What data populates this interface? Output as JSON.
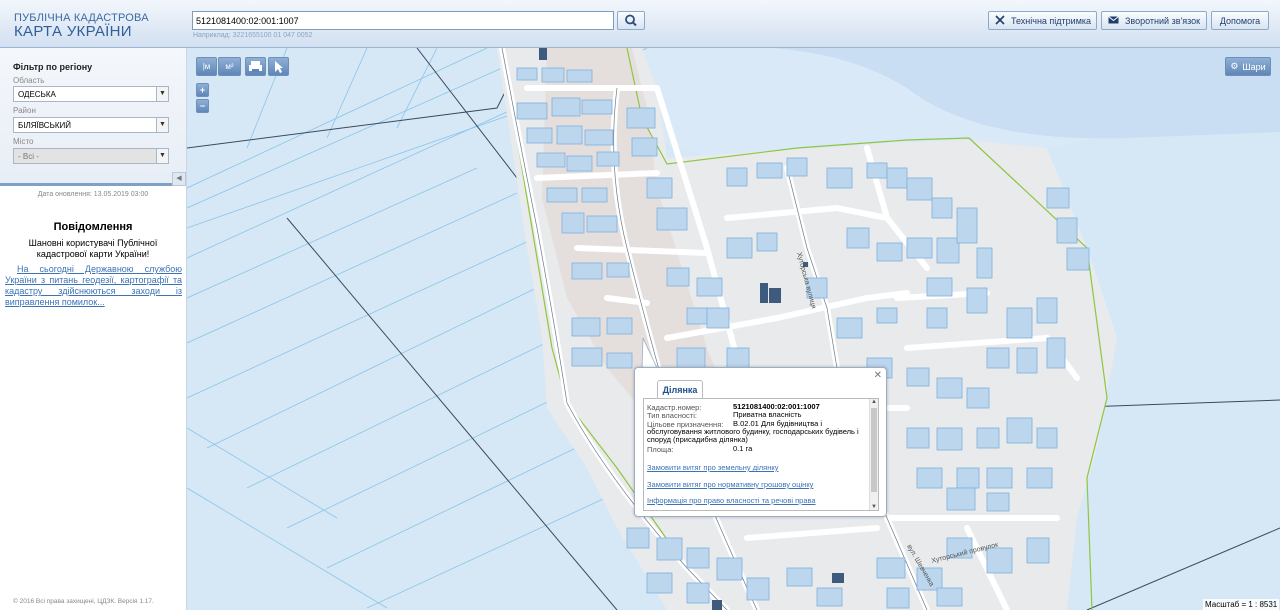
{
  "header": {
    "logo_line1": "ПУБЛІЧНА КАДАСТРОВА",
    "logo_line2": "КАРТА УКРАЇНИ",
    "search_value": "5121081400:02:001:1007",
    "search_example": "Наприклад: 3221655100 01 047 0052",
    "buttons": {
      "support": "Технічна підтримка",
      "feedback": "Зворотний зв'язок",
      "help": "Допомога"
    }
  },
  "sidebar": {
    "filter_title": "Фільтр по регіону",
    "region_label": "Область",
    "region_value": "ОДЕСЬКА",
    "district_label": "Район",
    "district_value": "БІЛЯЇВСЬКИЙ",
    "city_label": "Місто",
    "city_value": "- Всі -",
    "update_date": "Дата оновлення: 13.05.2019 03:00",
    "notice_title": "Повідомлення",
    "notice_greeting": "Шановні користувачі Публічної кадастрової карти України!",
    "notice_link": "На сьогодні Державною службою України з питань геодезії, картографії та кадастру здійснюються заходи із виправлення помилок...",
    "copyright": "© 2016 Всі права захищені, ЦДЗК. Версія 1.17."
  },
  "map": {
    "tools": {
      "ruler_m": "|м",
      "ruler_area": "м²",
      "print": "print-icon",
      "info": "info-cursor-icon",
      "zoom_in": "+",
      "zoom_out": "−"
    },
    "layers_label": "Шари",
    "scale_label": "Масштаб = 1 : 8531",
    "street_labels": [
      "вул. Шевченка",
      "Хуторський провулок",
      "Хуторська вулиця"
    ]
  },
  "popup": {
    "tab_label": "Ділянка",
    "rows": {
      "cadastre_label": "Кадастр.номер:",
      "cadastre_value": "5121081400:02:001:1007",
      "ownership_label": "Тип власності:",
      "ownership_value": "Приватна власність",
      "purpose_label": "Цільове призначення:",
      "purpose_value": "В.02.01 Для будівництва і обслуговування житлового будинку, господарських будівель і споруд (присадибна ділянка)",
      "area_label": "Площа:",
      "area_value": "0.1 га"
    },
    "links": {
      "extract_land": "Замовити витяг про земельну ділянку",
      "extract_valuation": "Замовити витяг про нормативну грошову оцінку",
      "rights_info": "Інформація про право власності та речові права"
    }
  },
  "colors": {
    "map_bg": "#d6e8f6",
    "parcel_fill": "#bcd6ee",
    "parcel_stroke": "#7fb0dc",
    "road": "#ffffff",
    "boundary": "#8fc640",
    "accent": "#3b73b5"
  }
}
